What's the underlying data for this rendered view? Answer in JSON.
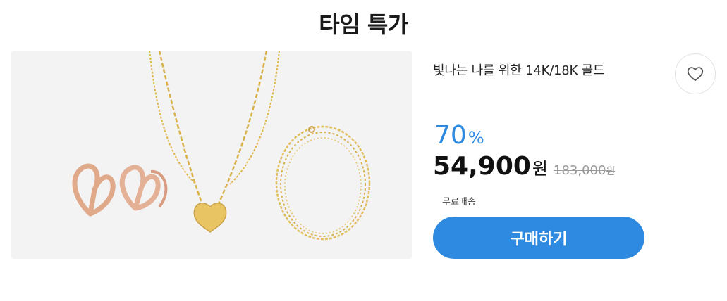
{
  "section": {
    "title": "타임 특가"
  },
  "product": {
    "name": "빛나는 나를 위한 14K/18K 골드",
    "image_alt": "gold jewelry set: heart earrings, heart pendant necklace, chain bracelet",
    "discount_value": "70",
    "discount_unit": "%",
    "price": "54,900",
    "price_unit": "원",
    "original_price": "183,000",
    "original_price_unit": "원",
    "shipping": "무료배송",
    "buy_label": "구매하기"
  },
  "icons": {
    "wishlist": "heart-outline-icon"
  },
  "colors": {
    "accent": "#2d8ae0",
    "image_bg": "#f3f3f3"
  }
}
